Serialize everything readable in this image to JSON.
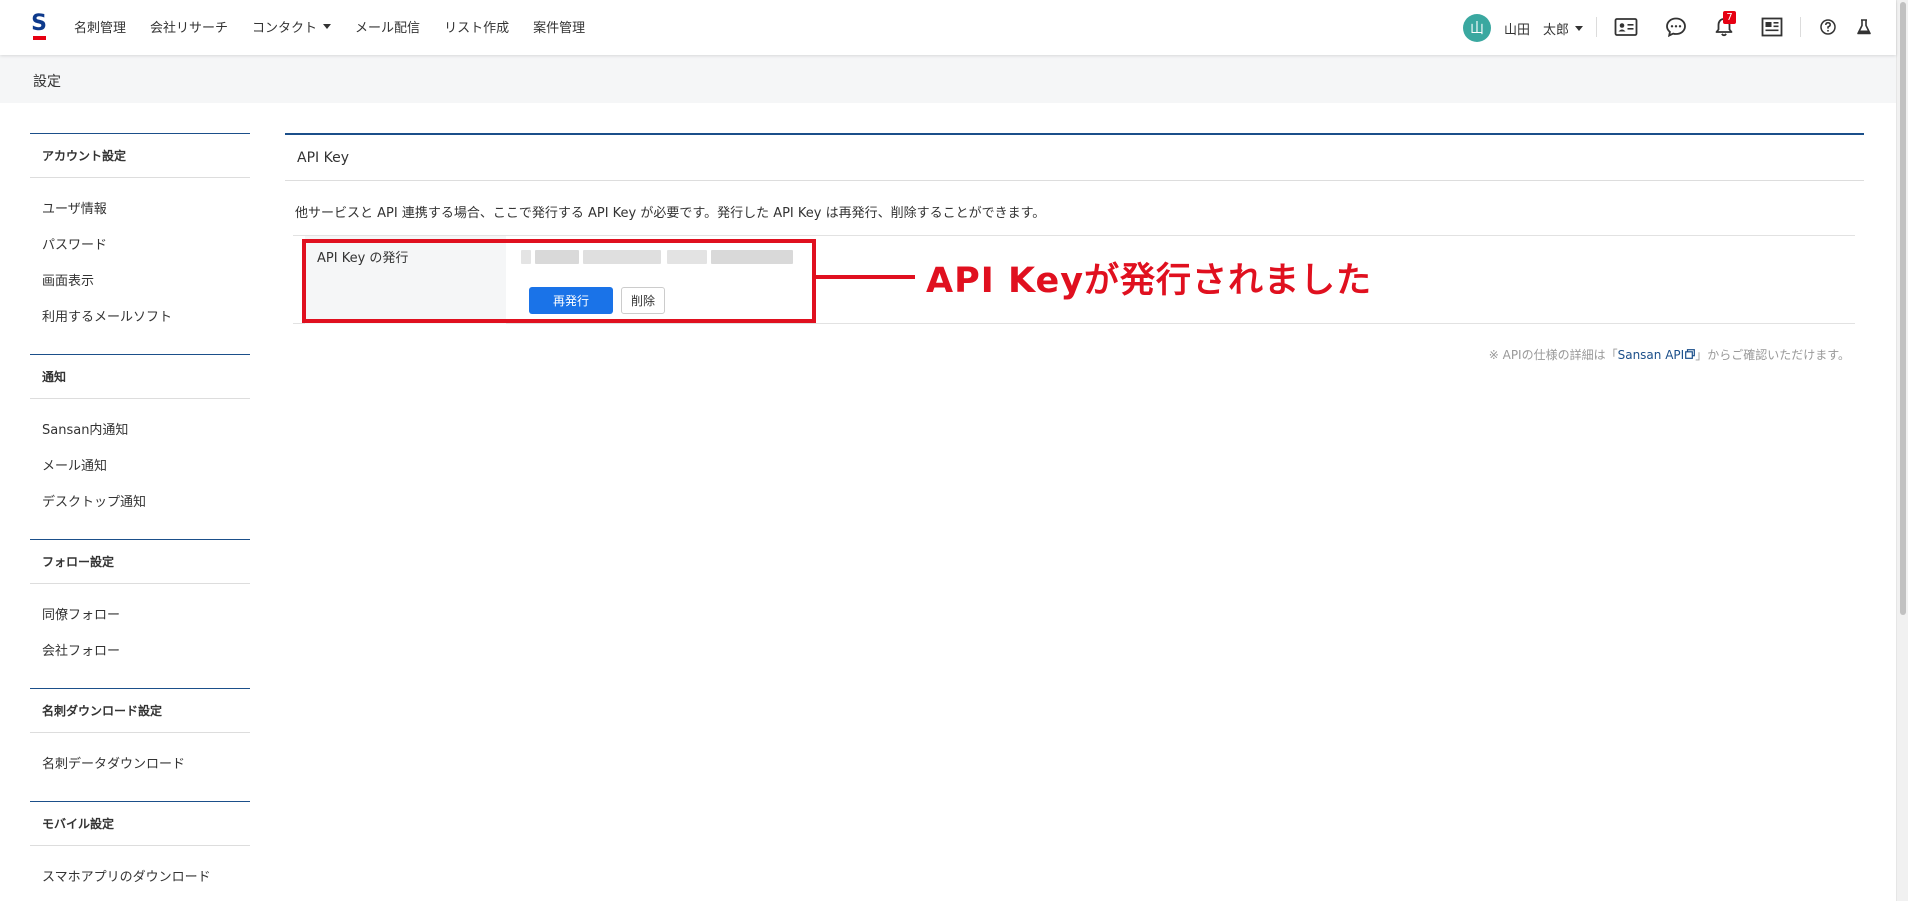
{
  "topnav": {
    "items": [
      "名刺管理",
      "会社リサーチ",
      "コンタクト",
      "メール配信",
      "リスト作成",
      "案件管理"
    ],
    "user": {
      "avatar_char": "山",
      "name": "山田　太郎"
    },
    "notification_count": "7",
    "icons": [
      "contact-card-icon",
      "chat-bubble-icon",
      "bell-icon",
      "news-icon",
      "help-icon",
      "lab-flask-icon"
    ]
  },
  "subheader": {
    "title": "設定"
  },
  "sidebar": {
    "sections": [
      {
        "title": "アカウント設定",
        "items": [
          "ユーザ情報",
          "パスワード",
          "画面表示",
          "利用するメールソフト"
        ]
      },
      {
        "title": "通知",
        "items": [
          "Sansan内通知",
          "メール通知",
          "デスクトップ通知"
        ]
      },
      {
        "title": "フォロー設定",
        "items": [
          "同僚フォロー",
          "会社フォロー"
        ]
      },
      {
        "title": "名刺ダウンロード設定",
        "items": [
          "名刺データダウンロード"
        ]
      },
      {
        "title": "モバイル設定",
        "items": [
          "スマホアプリのダウンロード"
        ]
      }
    ]
  },
  "main": {
    "title": "API Key",
    "description": "他サービスと API 連携する場合、ここで発行する API Key が必要です。発行した API Key は再発行、削除することができます。",
    "row_label": "API Key の発行",
    "reissue_label": "再発行",
    "delete_label": "削除",
    "footnote_prefix": "※ APIの仕様の詳細は「",
    "footnote_link": "Sansan API",
    "footnote_suffix": "」からご確認いただけます。"
  },
  "annotation": {
    "text": "API Keyが発行されました",
    "color": "#e0101f"
  },
  "colors": {
    "accent": "#1b4f8a",
    "primary_button": "#1a73e8",
    "brand_red": "#e60012"
  }
}
